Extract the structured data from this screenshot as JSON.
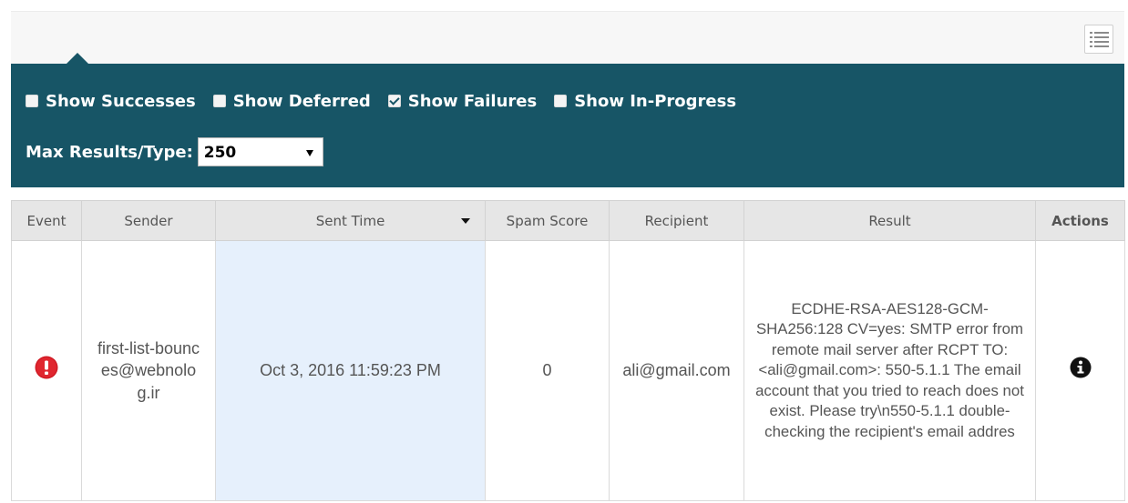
{
  "filters": {
    "checkboxes": [
      {
        "label": "Show Successes",
        "checked": false
      },
      {
        "label": "Show Deferred",
        "checked": false
      },
      {
        "label": "Show Failures",
        "checked": true
      },
      {
        "label": "Show In-Progress",
        "checked": false
      }
    ],
    "max_results_label": "Max Results/Type:",
    "max_results_value": "250"
  },
  "table": {
    "headers": [
      "Event",
      "Sender",
      "Sent Time",
      "Spam Score",
      "Recipient",
      "Result",
      "Actions"
    ],
    "sorted_column": "Sent Time",
    "rows": [
      {
        "event_icon": "error-exclamation-icon",
        "sender": "first-list-bounces@webnolog.ir",
        "sent_time": "Oct 3, 2016 11:59:23 PM",
        "spam_score": "0",
        "recipient": "ali@gmail.com",
        "result": "ECDHE-RSA-AES128-GCM-SHA256:128 CV=yes: SMTP error from remote mail server after RCPT TO: <ali@gmail.com>: 550-5.1.1 The email account that you tried to reach does not exist. Please try\\n550-5.1.1 double-checking the recipient's email addres",
        "action_icon": "info-icon"
      }
    ]
  },
  "colors": {
    "panel": "#175566",
    "header_bg": "#e6e6e6",
    "sorted_col_bg": "#e6f0fc",
    "error_red": "#d11b25"
  }
}
